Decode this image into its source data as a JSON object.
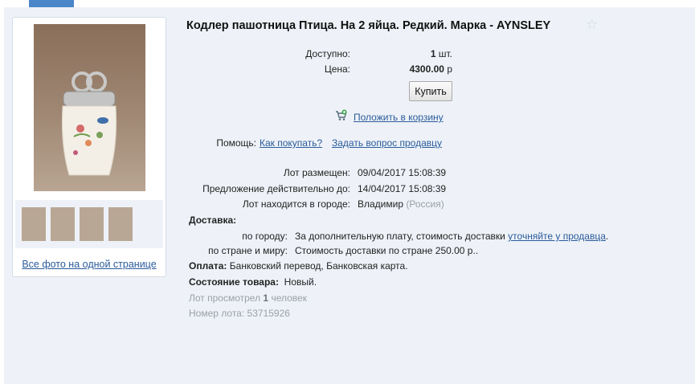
{
  "lot": {
    "title": "Кодлер пашотница Птица. На 2 яйца. Редкий. Марка - AYNSLEY",
    "available_label": "Доступно:",
    "available_value": "1",
    "available_unit": "шт.",
    "price_label": "Цена:",
    "price_value": "4300.00",
    "price_currency": "р",
    "buy_button": "Купить",
    "add_to_cart": "Положить в корзину",
    "help_label": "Помощь:",
    "help_link_how": "Как покупать?",
    "help_link_ask": "Задать вопрос продавцу",
    "posted_label": "Лот размещен:",
    "posted_value": "09/04/2017 15:08:39",
    "valid_label": "Предложение действительно до:",
    "valid_value": "14/04/2017 15:08:39",
    "city_label": "Лот находится в городе:",
    "city_value": "Владимир",
    "country_value": "(Россия)"
  },
  "delivery": {
    "heading": "Доставка:",
    "city_label": "по городу:",
    "city_text": "За дополнительную плату, стоимость доставки",
    "city_link": "уточняйте у продавца",
    "city_end": ".",
    "country_label": "по стране и миру:",
    "country_text": "Стоимость доставки по стране 250.00 р.."
  },
  "payment": {
    "label": "Оплата:",
    "value": "Банковский перевод, Банковская карта."
  },
  "condition": {
    "label": "Состояние товара:",
    "value": "Новый."
  },
  "stats": {
    "views_prefix": "Лот просмотрел",
    "views_count": "1",
    "views_suffix": "человек",
    "lot_number_label": "Номер лота:",
    "lot_number": "53715926"
  },
  "gallery": {
    "all_photos": "Все фото на одной странице"
  },
  "colors": {
    "link": "#2a5b9a",
    "panel": "#eef2f8",
    "muted": "#9aa0a7"
  }
}
